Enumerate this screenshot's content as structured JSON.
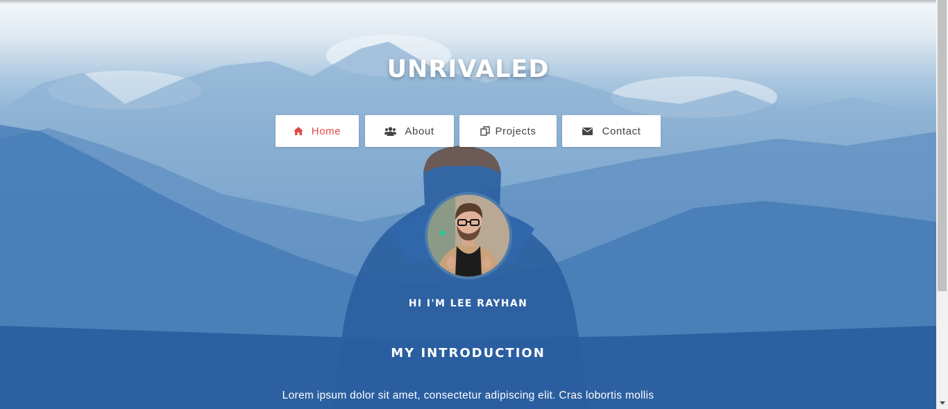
{
  "brand": {
    "title": "UNRIVALED"
  },
  "nav": {
    "items": [
      {
        "label": "Home",
        "icon": "home-icon",
        "active": true
      },
      {
        "label": "About",
        "icon": "users-icon",
        "active": false
      },
      {
        "label": "Projects",
        "icon": "copy-icon",
        "active": false
      },
      {
        "label": "Contact",
        "icon": "envelope-icon",
        "active": false
      }
    ]
  },
  "profile": {
    "greeting": "HI I'M LEE RAYHAN"
  },
  "intro": {
    "heading": "MY INTRODUCTION",
    "text": "Lorem ipsum dolor sit amet, consectetur adipiscing elit. Cras lobortis mollis"
  },
  "colors": {
    "accent": "#e04848",
    "nav_text": "#444444",
    "avatar_border": "#4d7cab"
  }
}
